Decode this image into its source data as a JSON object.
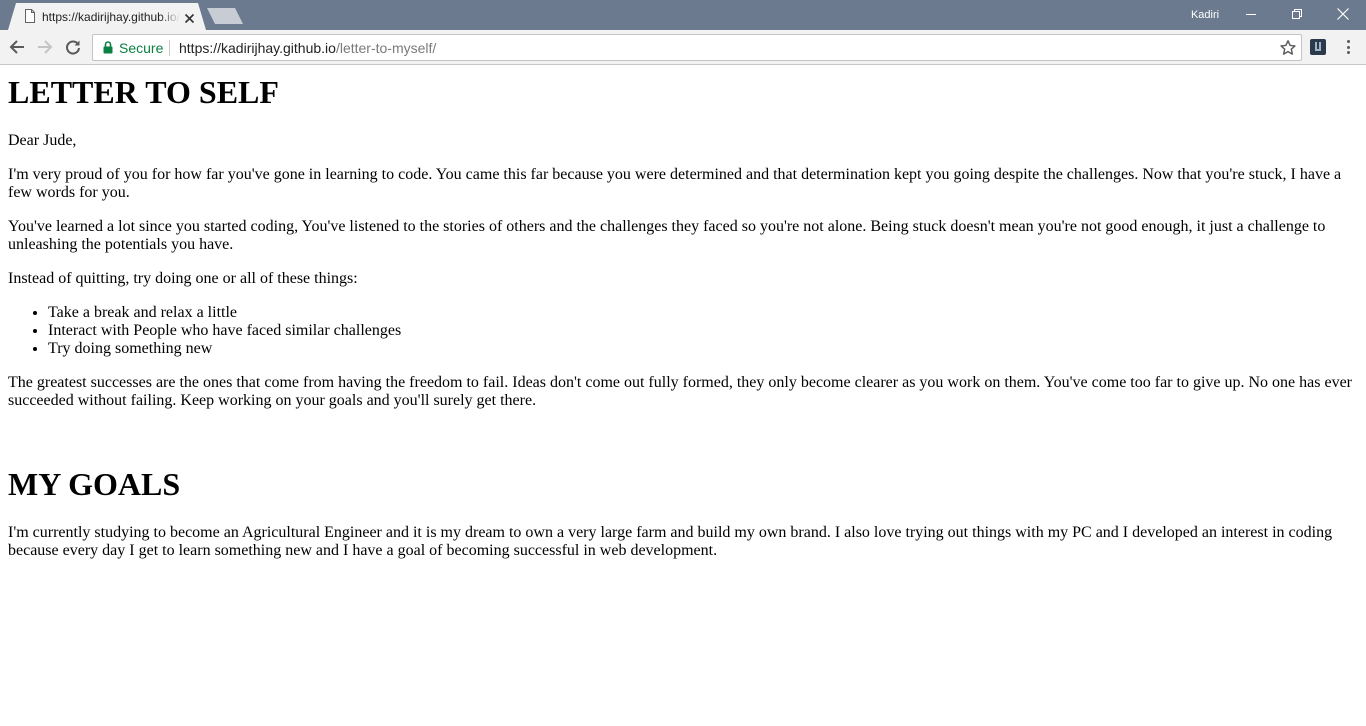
{
  "browser": {
    "tab": {
      "title": "https://kadirijhay.github.io/letter-to-myself/"
    },
    "profile_name": "Kadiri",
    "omnibox": {
      "security_label": "Secure",
      "url_scheme_host": "https://kadirijhay.github.io",
      "url_path": "/letter-to-myself/"
    },
    "colors": {
      "tabstrip": "#6b7a8f",
      "secure_green": "#0b8043"
    },
    "icons": {
      "tab_favicon": "page-icon",
      "tab_close": "close-icon",
      "back": "arrow-left-icon",
      "forward": "arrow-right-icon",
      "reload": "reload-icon",
      "lock": "lock-icon",
      "bookmark": "star-icon",
      "extension": "extension-icon",
      "menu": "kebab-menu-icon"
    }
  },
  "page": {
    "letter": {
      "heading": "LETTER TO SELF",
      "greeting": "Dear Jude,",
      "paragraph1": "I'm very proud of you for how far you've gone in learning to code. You came this far because you were determined and that determination kept you going despite the challenges. Now that you're stuck, I have a few words for you.",
      "paragraph2": "You've learned a lot since you started coding, You've listened to the stories of others and the challenges they faced so you're not alone. Being stuck doesn't mean you're not good enough, it just a challenge to unleashing the potentials you have.",
      "paragraph3": "Instead of quitting, try doing one or all of these things:",
      "list_items": [
        "Take a break and relax a little",
        "Interact with People who have faced similar challenges",
        "Try doing something new"
      ],
      "paragraph4": "The greatest successes are the ones that come from having the freedom to fail. Ideas don't come out fully formed, they only become clearer as you work on them. You've come too far to give up. No one has ever succeeded without failing. Keep working on your goals and you'll surely get there."
    },
    "goals": {
      "heading": "MY GOALS",
      "paragraph": "I'm currently studying to become an Agricultural Engineer and it is my dream to own a very large farm and build my own brand. I also love trying out things with my PC and I developed an interest in coding because every day I get to learn something new and I have a goal of becoming successful in web development."
    }
  }
}
